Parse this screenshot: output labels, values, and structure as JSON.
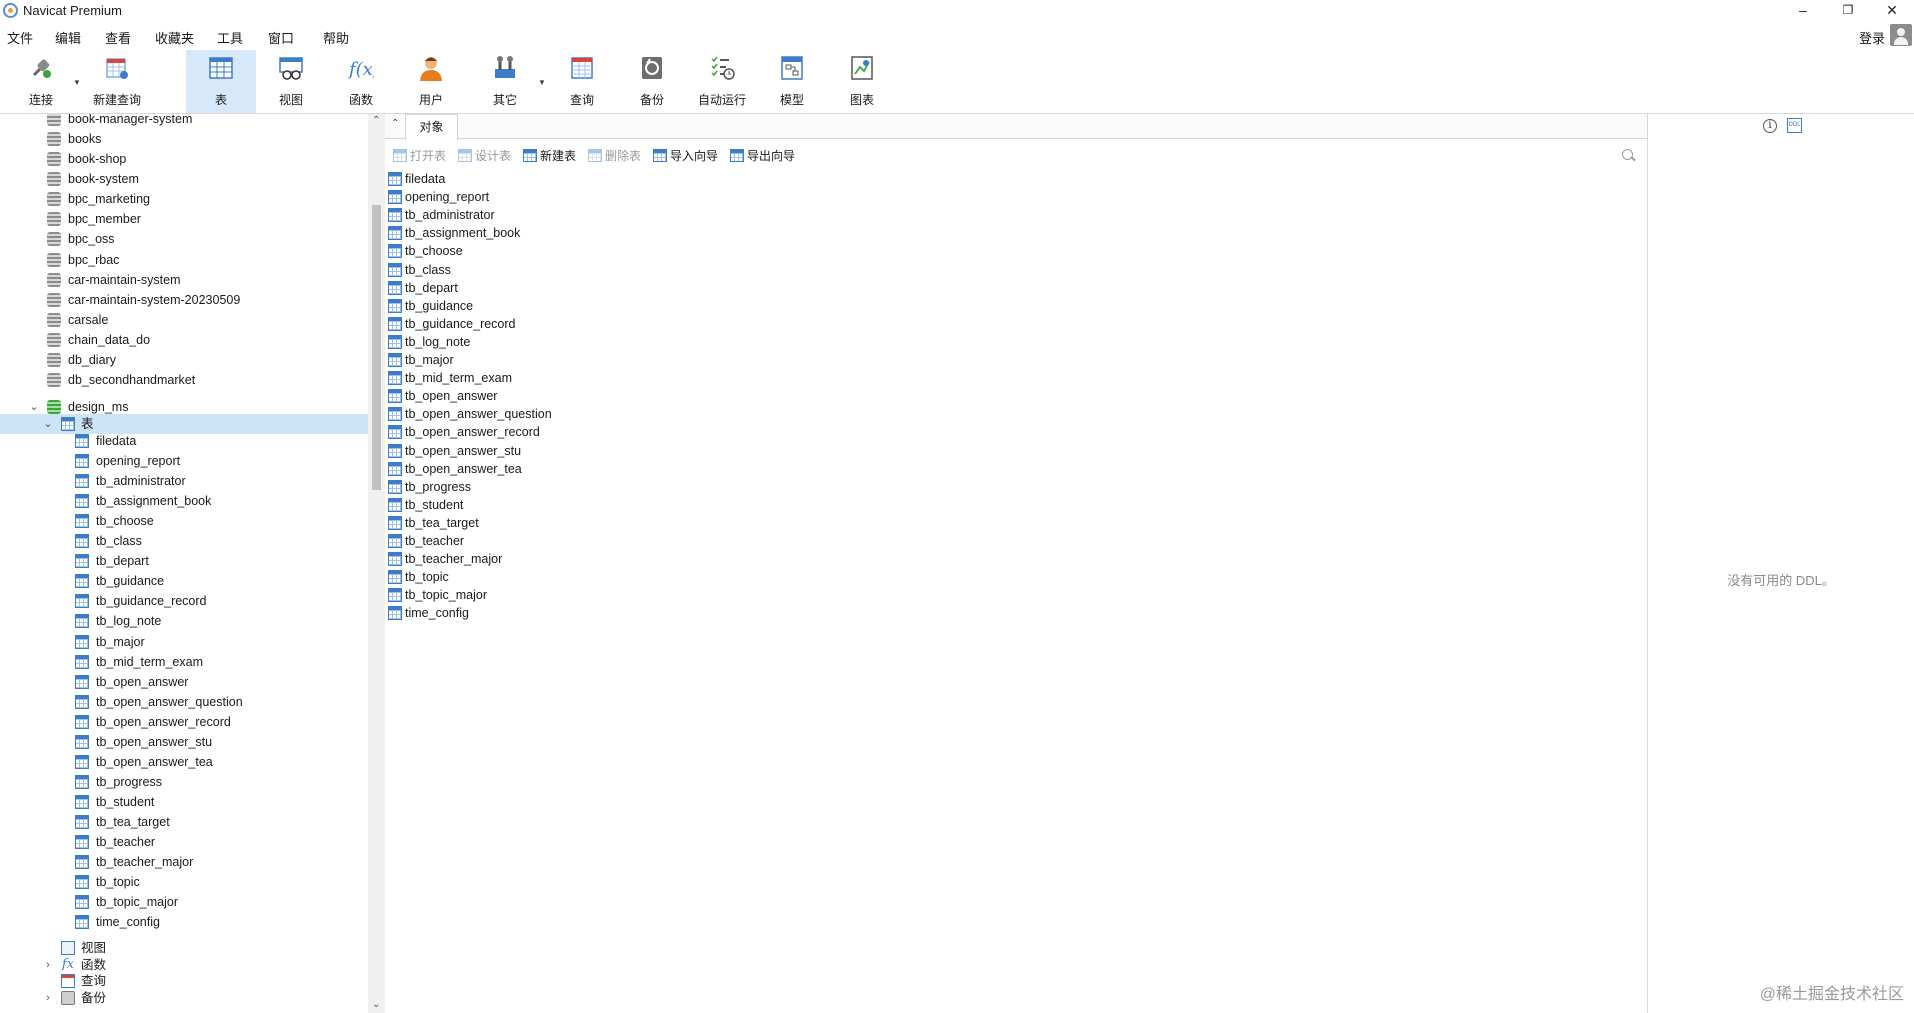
{
  "window": {
    "title": "Navicat Premium",
    "minimize": "–",
    "restore": "❐",
    "close": "✕"
  },
  "menu": [
    "文件",
    "编辑",
    "查看",
    "收藏夹",
    "工具",
    "窗口",
    "帮助"
  ],
  "login_label": "登录",
  "toolbar": [
    {
      "label": "连接",
      "icon": "plug-icon"
    },
    {
      "label": "新建查询",
      "icon": "new-query-icon"
    },
    {
      "label": "表",
      "icon": "table-icon",
      "active": true
    },
    {
      "label": "视图",
      "icon": "view-icon"
    },
    {
      "label": "函数",
      "icon": "function-icon"
    },
    {
      "label": "用户",
      "icon": "user-icon"
    },
    {
      "label": "其它",
      "icon": "tools-icon"
    },
    {
      "label": "查询",
      "icon": "query-icon"
    },
    {
      "label": "备份",
      "icon": "backup-icon"
    },
    {
      "label": "自动运行",
      "icon": "schedule-icon"
    },
    {
      "label": "模型",
      "icon": "model-icon"
    },
    {
      "label": "图表",
      "icon": "chart-icon"
    }
  ],
  "sidebar": {
    "databases": [
      "book-manager-system",
      "books",
      "book-shop",
      "book-system",
      "bpc_marketing",
      "bpc_member",
      "bpc_oss",
      "bpc_rbac",
      "car-maintain-system",
      "car-maintain-system-20230509",
      "carsale",
      "chain_data_do",
      "db_diary",
      "db_secondhandmarket"
    ],
    "open_db": "design_ms",
    "tables_node": "表",
    "tables": [
      "filedata",
      "opening_report",
      "tb_administrator",
      "tb_assignment_book",
      "tb_choose",
      "tb_class",
      "tb_depart",
      "tb_guidance",
      "tb_guidance_record",
      "tb_log_note",
      "tb_major",
      "tb_mid_term_exam",
      "tb_open_answer",
      "tb_open_answer_question",
      "tb_open_answer_record",
      "tb_open_answer_stu",
      "tb_open_answer_tea",
      "tb_progress",
      "tb_student",
      "tb_tea_target",
      "tb_teacher",
      "tb_teacher_major",
      "tb_topic",
      "tb_topic_major",
      "time_config"
    ],
    "other_nodes": [
      "视图",
      "函数",
      "查询",
      "备份"
    ]
  },
  "center": {
    "tab": "对象",
    "actions": [
      {
        "label": "打开表",
        "enabled": false
      },
      {
        "label": "设计表",
        "enabled": false
      },
      {
        "label": "新建表",
        "enabled": true
      },
      {
        "label": "删除表",
        "enabled": false
      },
      {
        "label": "导入向导",
        "enabled": true
      },
      {
        "label": "导出向导",
        "enabled": true
      }
    ],
    "objects": [
      "filedata",
      "opening_report",
      "tb_administrator",
      "tb_assignment_book",
      "tb_choose",
      "tb_class",
      "tb_depart",
      "tb_guidance",
      "tb_guidance_record",
      "tb_log_note",
      "tb_major",
      "tb_mid_term_exam",
      "tb_open_answer",
      "tb_open_answer_question",
      "tb_open_answer_record",
      "tb_open_answer_stu",
      "tb_open_answer_tea",
      "tb_progress",
      "tb_student",
      "tb_tea_target",
      "tb_teacher",
      "tb_teacher_major",
      "tb_topic",
      "tb_topic_major",
      "time_config"
    ]
  },
  "right": {
    "info_glyph": "i",
    "ddl_glyph": "DDL",
    "empty_text": "没有可用的 DDL。"
  },
  "watermark": "@稀土掘金技术社区"
}
